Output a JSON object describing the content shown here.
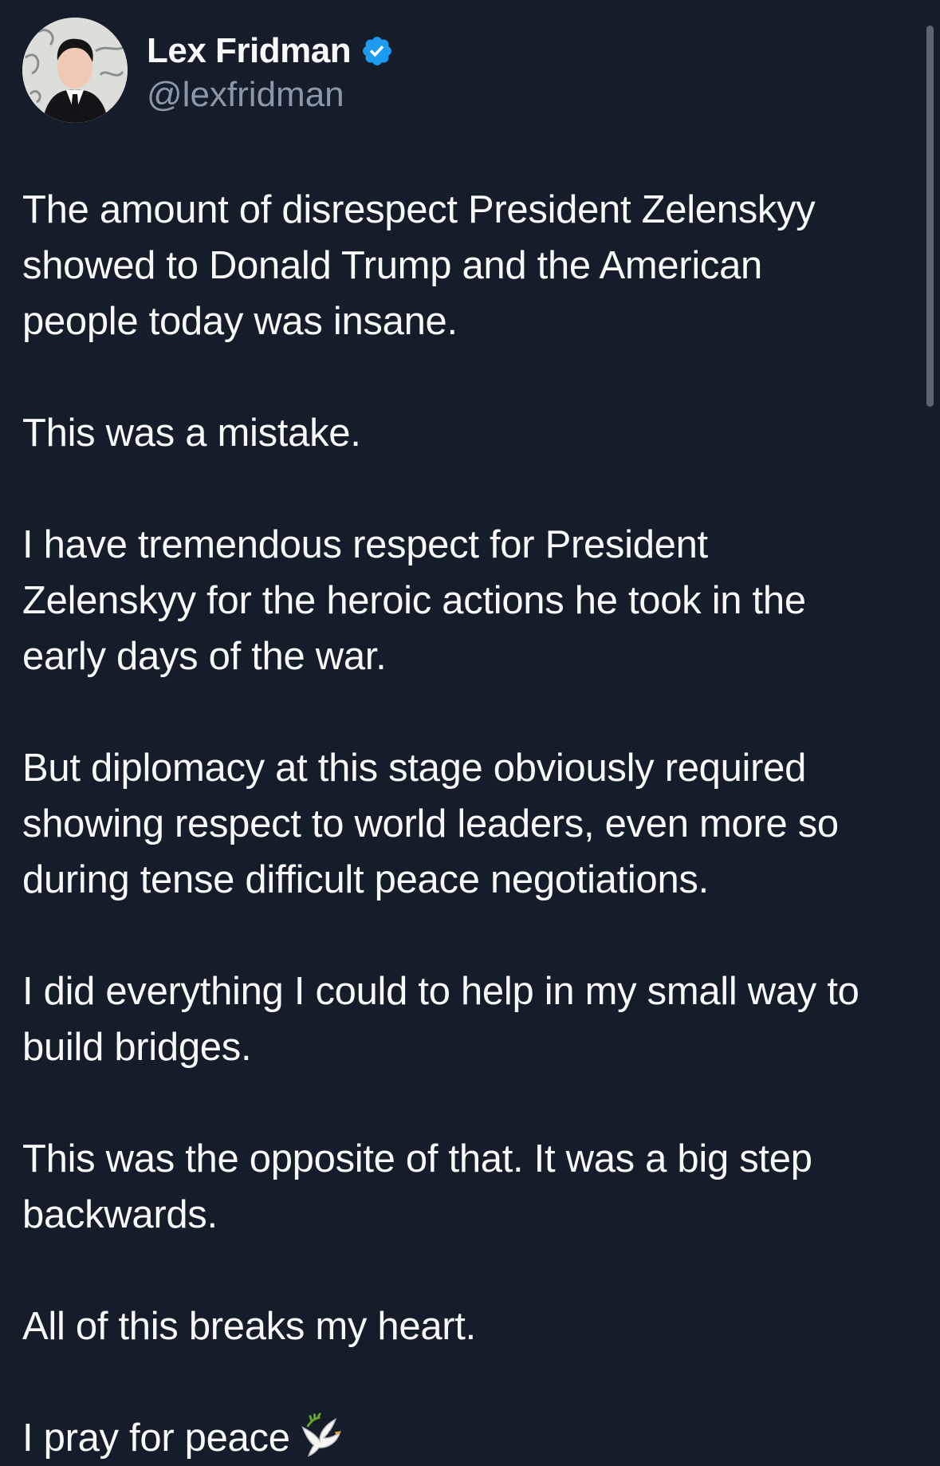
{
  "author": {
    "display_name": "Lex Fridman",
    "handle": "@lexfridman",
    "verified": true,
    "verified_icon": "verified-badge-icon",
    "avatar_icon": "profile-photo"
  },
  "tweet": {
    "paragraphs": [
      "The amount of disrespect President Zelenskyy\nshowed to Donald Trump and the American\npeople today was insane.",
      "This was a mistake.",
      "I have tremendous respect for President\nZelenskyy for the heroic actions he took in the\nearly days of the war.",
      "But diplomacy at this stage obviously required\nshowing respect to world leaders, even more so\nduring tense difficult peace negotiations.",
      "I did everything I could to help in my small way to\nbuild bridges.",
      "This was the opposite of that. It was a big step\nbackwards.",
      "All of this breaks my heart.",
      "I pray for peace"
    ],
    "final_emoji_icon": "dove-icon"
  },
  "colors": {
    "background": "#151d2a",
    "text": "#f7f9f9",
    "secondary_text": "#8b98a5",
    "verified_blue": "#1d9bf0"
  }
}
